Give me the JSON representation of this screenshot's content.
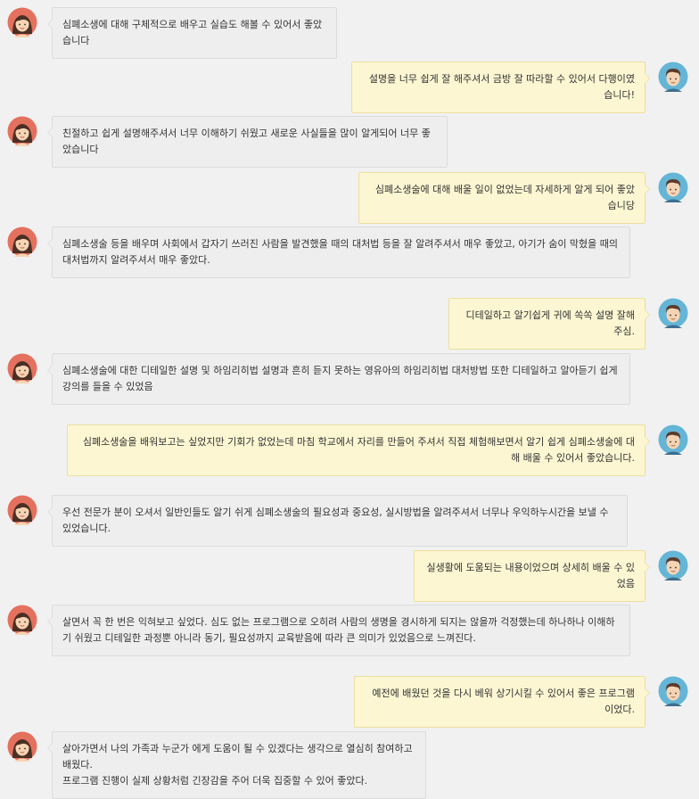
{
  "messages": [
    {
      "side": "left",
      "avatar": "female-avatar-icon",
      "text": "심폐소생에 대해 구체적으로 배우고 실습도 해볼 수 있어서 좋았습니다"
    },
    {
      "side": "right",
      "avatar": "male-avatar-icon",
      "text": "설명을 너무 쉽게 잘 해주셔서 금방 잘 따라할 수 있어서 다행이였습니다!"
    },
    {
      "side": "left",
      "avatar": "female-avatar-icon",
      "text": "친절하고 쉽게 설명해주셔서 너무 이해하기 쉬웠고 새로운 사실들을 많이 알게되어 너무 좋았습니다"
    },
    {
      "side": "right",
      "avatar": "male-avatar-icon",
      "text": "심폐소생술에 대해 배울 일이 없었는데 자세하게 알게 되어 좋았습니당"
    },
    {
      "side": "left",
      "avatar": "female-avatar-icon",
      "text": "심폐소생술 등을 배우며 사회에서 갑자기 쓰러진 사람을 발견했을 때의 대처법 등을 잘 알려주셔서 매우 좋았고, 아기가 숨이 막혔을 때의 대처법까지 알려주셔서 매우 좋았다."
    },
    {
      "side": "right",
      "avatar": "male-avatar-icon",
      "text": "디테일하고 알기쉽게 귀에 쏙쏙 설명 잘해주심."
    },
    {
      "side": "left",
      "avatar": "female-avatar-icon",
      "text": "심폐소생술에 대한 디테일한 설명 및 하임리히법 설명과 흔히 듣지 못하는 영유아의 하임리히법 대처방법 또한 디테일하고 알아듣기 쉽게 강의를 들을 수 있었음"
    },
    {
      "side": "right",
      "avatar": "male-avatar-icon",
      "text": "심폐소생술을 배워보고는 싶었지만 기회가 없었는데 마침 학교에서 자리를 만들어 주셔서 직접 체험해보면서 알기 쉽게 심폐소생술에 대해 배울 수 있어서 좋았습니다."
    },
    {
      "side": "left",
      "avatar": "female-avatar-icon",
      "text": "우선 전문가 분이 오셔서 일반인들도 알기 쉬게 심폐소생술의 필요성과 중요성, 실시방법을 알려주셔서 너무나 우익하누시간을 보낼 수 있었습니다."
    },
    {
      "side": "right",
      "avatar": "male-avatar-icon",
      "text": "실생활에 도움되는 내용이었으며 상세히 배울 수 있었음"
    },
    {
      "side": "left",
      "avatar": "female-avatar-icon",
      "text": "살면서 꼭 한 번은 익혀보고 싶었다. 심도 없는 프로그램으로 오히려 사람의 생명을 경시하게 되지는 않을까 걱정했는데 하나하나 이해하기 쉬웠고 디테일한 과정뿐 아니라 동기, 필요성까지 교육받음에 따라 큰 의미가 있었음으로 느껴진다."
    },
    {
      "side": "right",
      "avatar": "male-avatar-icon",
      "text": "예전에 배웠던 것을 다시 베워 상기시킬 수 있어서 좋은 프로그램이었다."
    },
    {
      "side": "left",
      "avatar": "female-avatar-icon",
      "text": "살아가면서 나의 가족과 누군가 에게 도움이 될 수 있겠다는 생각으로 열심히 참여하고 배웠다.\n프로그램 진행이 실제 상황처럼 긴장감을 주어 더욱 집중할 수 있어 좋았다."
    }
  ]
}
